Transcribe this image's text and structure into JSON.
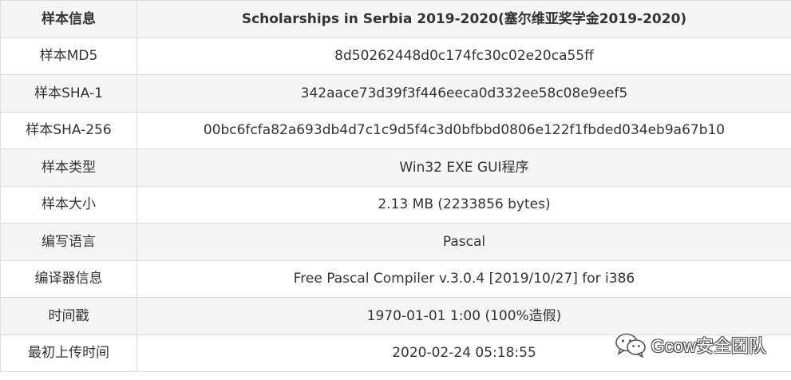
{
  "table": {
    "header": {
      "key": "样本信息",
      "value": "Scholarships in Serbia 2019-2020(塞尔维亚奖学金2019-2020)"
    },
    "rows": [
      {
        "key": "样本MD5",
        "value": "8d50262448d0c174fc30c02e20ca55ff"
      },
      {
        "key": "样本SHA-1",
        "value": "342aace73d39f3f446eeca0d332ee58c08e9eef5"
      },
      {
        "key": "样本SHA-256",
        "value": "00bc6fcfa82a693db4d7c1c9d5f4c3d0bfbbd0806e122f1fbded034eb9a67b10"
      },
      {
        "key": "样本类型",
        "value": "Win32 EXE GUI程序"
      },
      {
        "key": "样本大小",
        "value": "2.13 MB (2233856 bytes)"
      },
      {
        "key": "编写语言",
        "value": "Pascal"
      },
      {
        "key": "编译器信息",
        "value": "Free Pascal Compiler v.3.0.4 [2019/10/27] for i386"
      },
      {
        "key": "时间戳",
        "value": "1970-01-01 1:00 (100%造假)"
      },
      {
        "key": "最初上传时间",
        "value": "2020-02-24 05:18:55"
      }
    ]
  },
  "watermark": {
    "text": "Gcow安全团队",
    "icon": "wechat-icon"
  },
  "colors": {
    "border": "#dddddd",
    "stripe": "#f5f5f5",
    "text": "#333333"
  }
}
